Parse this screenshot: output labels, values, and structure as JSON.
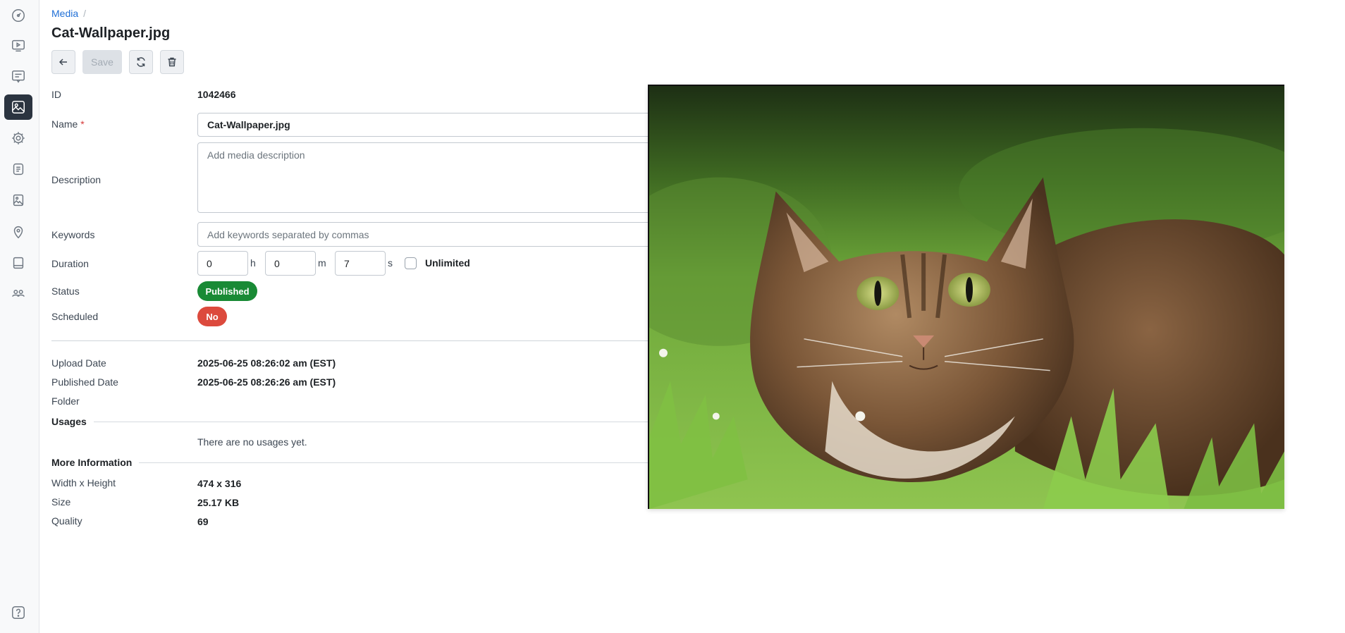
{
  "breadcrumb": {
    "root": "Media",
    "separator": "/"
  },
  "page_title": "Cat-Wallpaper.jpg",
  "toolbar": {
    "back_icon": "arrow-left-icon",
    "save_label": "Save",
    "refresh_icon": "refresh-icon",
    "delete_icon": "trash-icon"
  },
  "sidebar": {
    "items": [
      {
        "icon": "dashboard-icon"
      },
      {
        "icon": "player-icon"
      },
      {
        "icon": "message-icon"
      },
      {
        "icon": "media-icon",
        "active": true
      },
      {
        "icon": "gear-icon"
      },
      {
        "icon": "document-icon"
      },
      {
        "icon": "image-icon"
      },
      {
        "icon": "location-pin-icon"
      },
      {
        "icon": "book-icon"
      },
      {
        "icon": "users-icon"
      }
    ],
    "help_icon": "help-icon"
  },
  "details": {
    "id_label": "ID",
    "id_value": "1042466",
    "name_label": "Name",
    "name_required": "*",
    "name_value": "Cat-Wallpaper.jpg",
    "description_label": "Description",
    "description_placeholder": "Add media description",
    "keywords_label": "Keywords",
    "keywords_placeholder": "Add keywords separated by commas",
    "duration_label": "Duration",
    "duration_hours": "0",
    "duration_minutes": "0",
    "duration_seconds": "7",
    "unit_h": "h",
    "unit_m": "m",
    "unit_s": "s",
    "unlimited_label": "Unlimited",
    "status_label": "Status",
    "status_value": "Published",
    "scheduled_label": "Scheduled",
    "scheduled_value": "No"
  },
  "dates": {
    "upload_label": "Upload Date",
    "upload_value": "2025-06-25 08:26:02 am (EST)",
    "published_label": "Published Date",
    "published_value": "2025-06-25 08:26:26 am (EST)",
    "folder_label": "Folder"
  },
  "usages": {
    "title": "Usages",
    "empty_text": "There are no usages yet."
  },
  "more_info": {
    "title": "More Information",
    "dimensions_label": "Width x Height",
    "dimensions_value": "474 x 316",
    "size_label": "Size",
    "size_value": "25.17 KB",
    "quality_label": "Quality",
    "quality_value": "69"
  },
  "colors": {
    "published": "#198a35",
    "scheduled_no": "#dc4a3d",
    "link": "#1f6fd6",
    "sidebar_active": "#2b3440"
  }
}
